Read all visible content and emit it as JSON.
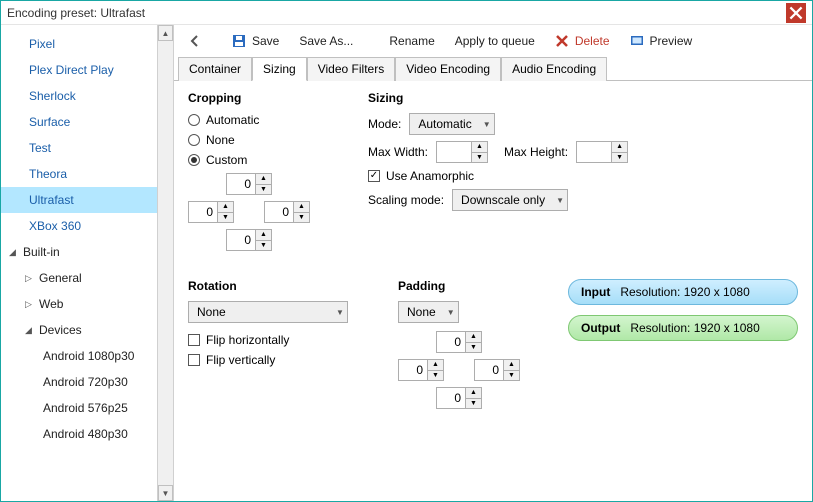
{
  "window": {
    "title": "Encoding preset: Ultrafast"
  },
  "sidebar": {
    "presets": [
      "Pixel",
      "Plex Direct Play",
      "Sherlock",
      "Surface",
      "Test",
      "Theora",
      "Ultrafast",
      "XBox 360"
    ],
    "selected": "Ultrafast",
    "builtin_label": "Built-in",
    "sub": {
      "general": "General",
      "web": "Web",
      "devices": "Devices"
    },
    "devices": [
      "Android 1080p30",
      "Android 720p30",
      "Android 576p25",
      "Android 480p30"
    ]
  },
  "toolbar": {
    "save": "Save",
    "save_as": "Save As...",
    "rename": "Rename",
    "apply": "Apply to queue",
    "delete": "Delete",
    "preview": "Preview"
  },
  "tabs": [
    "Container",
    "Sizing",
    "Video Filters",
    "Video Encoding",
    "Audio Encoding"
  ],
  "active_tab": "Sizing",
  "cropping": {
    "heading": "Cropping",
    "automatic": "Automatic",
    "none": "None",
    "custom": "Custom",
    "top": "0",
    "left": "0",
    "right": "0",
    "bottom": "0"
  },
  "sizing": {
    "heading": "Sizing",
    "mode_label": "Mode:",
    "mode_value": "Automatic",
    "maxw_label": "Max Width:",
    "maxw_value": "",
    "maxh_label": "Max Height:",
    "maxh_value": "",
    "use_ana": "Use Anamorphic",
    "scaling_label": "Scaling mode:",
    "scaling_value": "Downscale only"
  },
  "rotation": {
    "heading": "Rotation",
    "value": "None",
    "flip_h": "Flip horizontally",
    "flip_v": "Flip vertically"
  },
  "padding": {
    "heading": "Padding",
    "value": "None",
    "top": "0",
    "left": "0",
    "right": "0",
    "bottom": "0"
  },
  "resolution": {
    "input_label": "Input",
    "input_text": "Resolution: 1920 x 1080",
    "output_label": "Output",
    "output_text": "Resolution: 1920 x 1080"
  }
}
